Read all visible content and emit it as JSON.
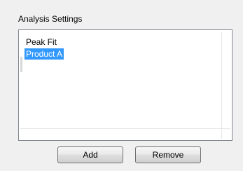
{
  "group": {
    "title": "Analysis Settings"
  },
  "list": {
    "items": [
      {
        "label": "Peak Fit",
        "selected": false
      },
      {
        "label": "Product A",
        "selected": true
      }
    ]
  },
  "buttons": {
    "add_label": "Add",
    "remove_label": "Remove"
  },
  "colors": {
    "selection_bg": "#3399ff",
    "selection_fg": "#ffffff",
    "list_border": "#828790",
    "panel_bg": "#f0f0f0"
  }
}
